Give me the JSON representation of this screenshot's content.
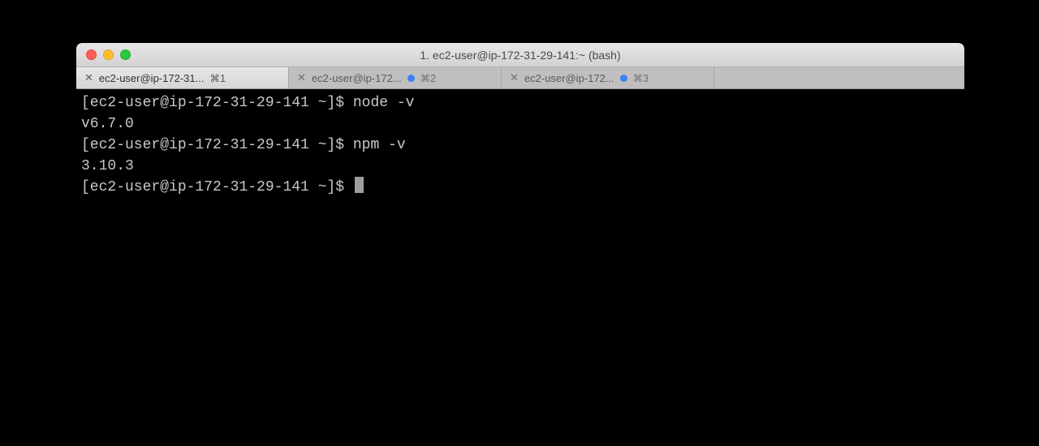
{
  "window": {
    "title": "1. ec2-user@ip-172-31-29-141:~ (bash)"
  },
  "tabs": [
    {
      "label": "ec2-user@ip-172-31...",
      "shortcut": "⌘1",
      "modified": false,
      "active": true
    },
    {
      "label": "ec2-user@ip-172...",
      "shortcut": "⌘2",
      "modified": true,
      "active": false
    },
    {
      "label": "ec2-user@ip-172...",
      "shortcut": "⌘3",
      "modified": true,
      "active": false
    }
  ],
  "terminal": {
    "prompt": "[ec2-user@ip-172-31-29-141 ~]$ ",
    "lines": [
      {
        "prompt": true,
        "cmd": "node -v"
      },
      {
        "prompt": false,
        "text": "v6.7.0"
      },
      {
        "prompt": true,
        "cmd": "npm -v"
      },
      {
        "prompt": false,
        "text": "3.10.3"
      },
      {
        "prompt": true,
        "cmd": "",
        "cursor": true
      }
    ]
  }
}
